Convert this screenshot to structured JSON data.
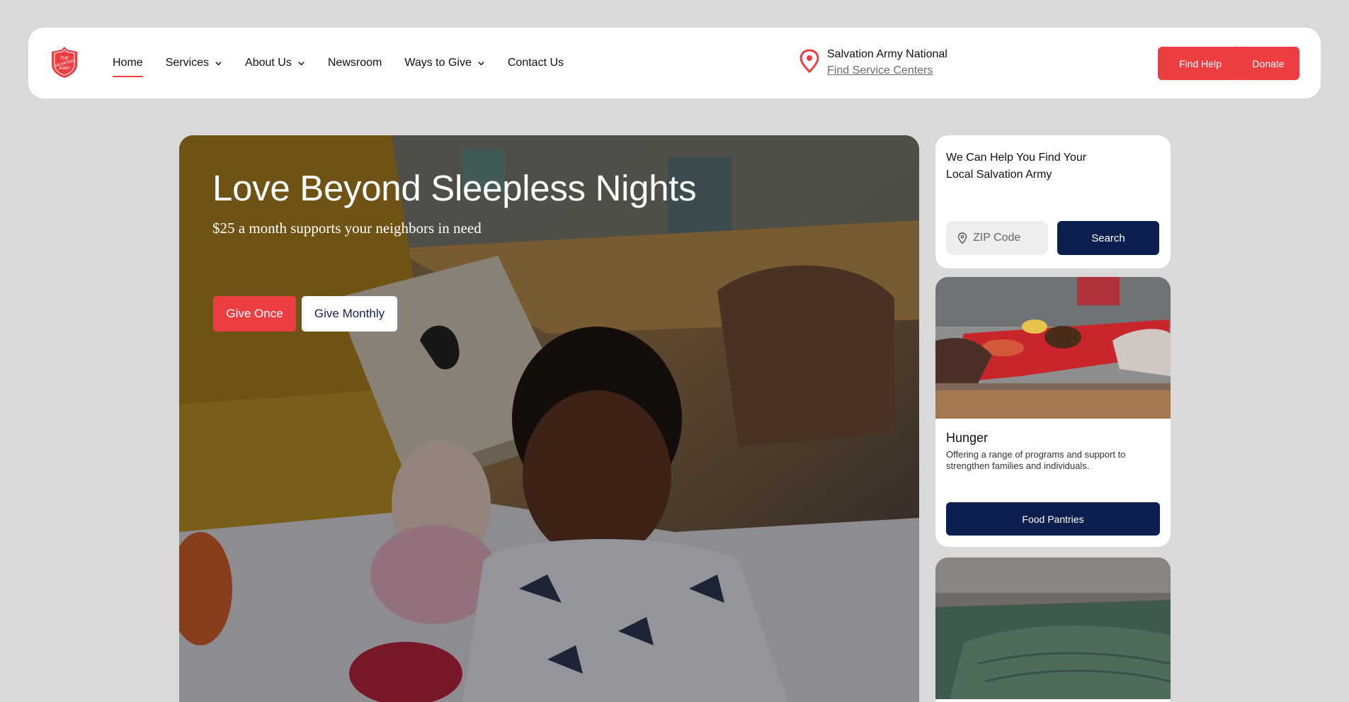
{
  "header": {
    "logo_text": "THE SALVATION ARMY",
    "nav": [
      {
        "label": "Home",
        "has_dropdown": false,
        "active": true
      },
      {
        "label": "Services",
        "has_dropdown": true
      },
      {
        "label": "About Us",
        "has_dropdown": true
      },
      {
        "label": "Newsroom",
        "has_dropdown": false
      },
      {
        "label": "Ways to Give",
        "has_dropdown": true
      },
      {
        "label": "Contact Us",
        "has_dropdown": false
      }
    ],
    "location_name": "Salvation Army National",
    "location_link": "Find Service Centers",
    "find_help": "Find Help",
    "donate": "Donate"
  },
  "hero": {
    "title": "Love Beyond Sleepless Nights",
    "subtitle": "$25 a month supports your neighbors in need",
    "give_once": "Give Once",
    "give_monthly": "Give Monthly"
  },
  "search_card": {
    "heading": "We Can Help You Find Your Local Salvation Army",
    "zip_placeholder": "ZIP Code",
    "zip_value": "",
    "search_button": "Search"
  },
  "hunger_card": {
    "title": "Hunger",
    "description": "Offering a range of programs and support to strengthen families and individuals.",
    "button": "Food Pantries"
  },
  "colors": {
    "brand_red": "#ef3e42",
    "navy": "#0d1f4f",
    "background": "#d9d9d9"
  },
  "icons": [
    "salvation-army-shield-logo",
    "chevron-down-icon",
    "map-pin-icon"
  ]
}
